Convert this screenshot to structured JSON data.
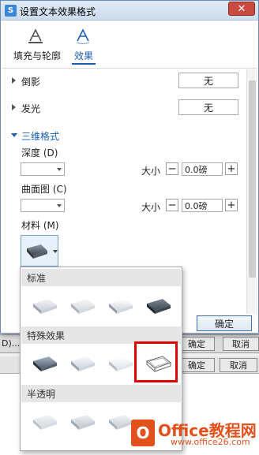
{
  "window": {
    "title": "设置文本效果格式",
    "close_glyph": "✕",
    "icon": "wps-icon"
  },
  "tabs": [
    {
      "label": "填充与轮廓",
      "icon": "text-fill-outline-icon"
    },
    {
      "label": "效果",
      "icon": "text-effect-icon",
      "selected": true
    }
  ],
  "shadow": {
    "label": "倒影",
    "value": "无"
  },
  "glow": {
    "label": "发光",
    "value": "无"
  },
  "format3d": {
    "section_label": "三维格式",
    "depth_label": "深度 (D)",
    "depth_size_label": "大小",
    "depth_size_value": "0.0磅",
    "contour_label": "曲面图 (C)",
    "contour_size_label": "大小",
    "contour_size_value": "0.0磅",
    "material_label": "材料 (M)",
    "minus": "−",
    "plus": "+"
  },
  "ok_label": "确定",
  "material_popup": {
    "sections": [
      {
        "title": "标准",
        "items": [
          "matte",
          "warm-matte",
          "plastic",
          "metal"
        ]
      },
      {
        "title": "特殊效果",
        "items": [
          "dark-edge",
          "soft-edge",
          "flat",
          "wireframe"
        ]
      },
      {
        "title": "半透明",
        "items": [
          "powder",
          "clear",
          "translucent-powder"
        ]
      }
    ],
    "highlighted_item": "wireframe"
  },
  "background": {
    "buttons1": [
      "确定",
      "取消"
    ],
    "buttons2": [
      "确定",
      "取消"
    ],
    "left_text": "D)..."
  },
  "watermark": {
    "text": "Office教程网",
    "sub": "www.office26.com"
  },
  "colors": {
    "accent": "#1a5fb4",
    "highlight": "#e00000",
    "logo": "#e2511b"
  }
}
